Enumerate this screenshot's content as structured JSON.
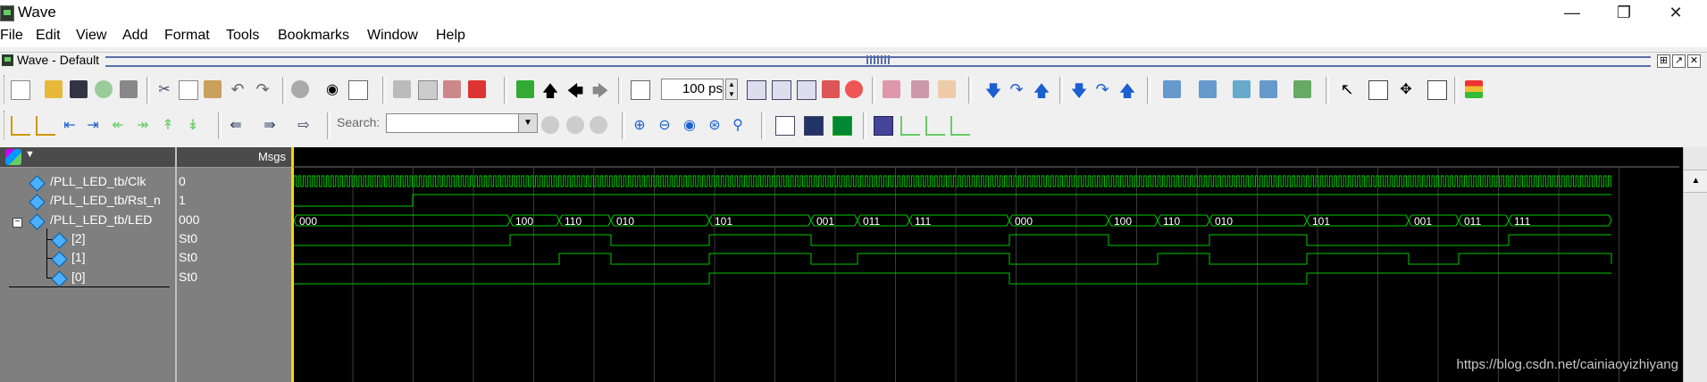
{
  "window": {
    "title": "Wave"
  },
  "menu": [
    "File",
    "Edit",
    "View",
    "Add",
    "Format",
    "Tools",
    "Bookmarks",
    "Window",
    "Help"
  ],
  "pane": {
    "title": "Wave - Default"
  },
  "toolbar": {
    "time_value": "100 ps",
    "search_label": "Search:",
    "search_value": ""
  },
  "header": {
    "msgs_label": "Msgs"
  },
  "signals": [
    {
      "name": "/PLL_LED_tb/Clk",
      "value": "0"
    },
    {
      "name": "/PLL_LED_tb/Rst_n",
      "value": "1"
    },
    {
      "name": "/PLL_LED_tb/LED",
      "value": "000"
    },
    {
      "name": "[2]",
      "value": "St0"
    },
    {
      "name": "[1]",
      "value": "St0"
    },
    {
      "name": "[0]",
      "value": "St0"
    }
  ],
  "bus_labels": [
    "000",
    "100",
    "110",
    "010",
    "101",
    "001",
    "011",
    "111",
    "000",
    "100",
    "110",
    "010",
    "101",
    "001",
    "011",
    "111"
  ],
  "watermark": "https://blog.csdn.net/cainiaoyizhiyang",
  "colors": {
    "wave": "#00c800",
    "cursor": "#ffd700",
    "grid": "#3a3a3a",
    "background": "#000000"
  }
}
